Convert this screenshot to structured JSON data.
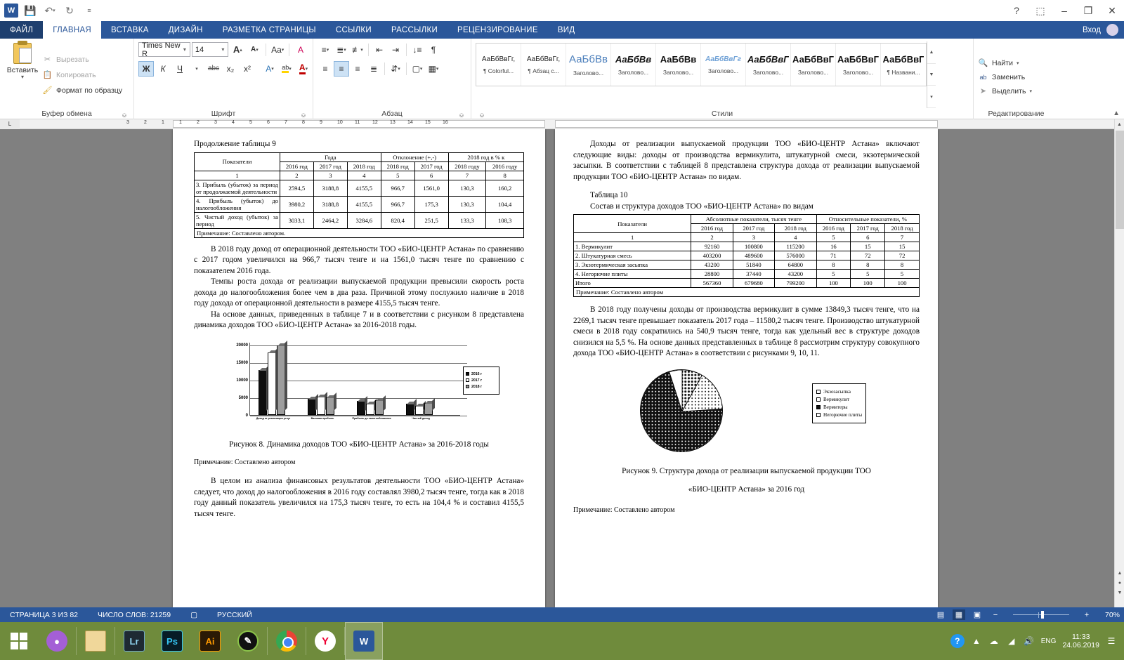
{
  "titlebar": {
    "app_icon": "word-logo",
    "quick_access": [
      {
        "name": "save-icon",
        "glyph": "💾"
      },
      {
        "name": "undo-icon",
        "glyph": "↶"
      },
      {
        "name": "redo-icon",
        "glyph": "↻"
      },
      {
        "name": "customize-qat-icon",
        "glyph": "≡"
      }
    ],
    "window_controls": [
      {
        "name": "help-icon",
        "glyph": "?"
      },
      {
        "name": "ribbon-display-icon",
        "glyph": "⬚"
      },
      {
        "name": "minimize-icon",
        "glyph": "–"
      },
      {
        "name": "restore-icon",
        "glyph": "❐"
      },
      {
        "name": "close-icon",
        "glyph": "✕"
      }
    ]
  },
  "tabs": {
    "file": "ФАЙЛ",
    "items": [
      {
        "label": "ГЛАВНАЯ",
        "active": true
      },
      {
        "label": "ВСТАВКА",
        "active": false
      },
      {
        "label": "ДИЗАЙН",
        "active": false
      },
      {
        "label": "РАЗМЕТКА СТРАНИЦЫ",
        "active": false
      },
      {
        "label": "ССЫЛКИ",
        "active": false
      },
      {
        "label": "РАССЫЛКИ",
        "active": false
      },
      {
        "label": "РЕЦЕНЗИРОВАНИЕ",
        "active": false
      },
      {
        "label": "ВИД",
        "active": false
      }
    ],
    "signin": "Вход"
  },
  "ribbon": {
    "clipboard": {
      "group_label": "Буфер обмена",
      "paste": "Вставить",
      "cut": "Вырезать",
      "copy": "Копировать",
      "format_painter": "Формат по образцу"
    },
    "font": {
      "group_label": "Шрифт",
      "font_name": "Times New R",
      "font_size": "14",
      "bold": "Ж",
      "italic": "К",
      "underline": "Ч",
      "strike": "abc",
      "subscript": "x₂",
      "superscript": "x²",
      "text_effects": "A",
      "highlight": "ab",
      "font_color": "A",
      "grow": "A",
      "shrink": "A",
      "case": "Aa",
      "clear_format": "A"
    },
    "paragraph": {
      "group_label": "Абзац"
    },
    "styles": {
      "group_label": "Стили",
      "items": [
        {
          "sample": "АаБбВвГг,",
          "name": "¶ Colorful...",
          "kind": "plain"
        },
        {
          "sample": "АаБбВвГг,",
          "name": "¶ Абзац с...",
          "kind": "plain"
        },
        {
          "sample": "АаБбВв",
          "name": "Заголово...",
          "kind": "blue-large"
        },
        {
          "sample": "АаБбВв",
          "name": "Заголово...",
          "kind": "bold-italic"
        },
        {
          "sample": "АаБбВв",
          "name": "Заголово...",
          "kind": "bold"
        },
        {
          "sample": "АаБбВвГг",
          "name": "Заголово...",
          "kind": "blue-italic"
        },
        {
          "sample": "АаБбВвГ",
          "name": "Заголово...",
          "kind": "bold-italic"
        },
        {
          "sample": "АаБбВвГ",
          "name": "Заголово...",
          "kind": "bold"
        },
        {
          "sample": "АаБбВвГ",
          "name": "Заголово...",
          "kind": "bold"
        },
        {
          "sample": "АаБбВвГ",
          "name": "¶ Названи...",
          "kind": "bold"
        }
      ]
    },
    "editing": {
      "group_label": "Редактирование",
      "find": "Найти",
      "replace": "Заменить",
      "select": "Выделить"
    }
  },
  "ruler": {
    "corner": "L",
    "numbers": [
      "3",
      "2",
      "1",
      "1",
      "2",
      "3",
      "4",
      "5",
      "6",
      "7",
      "8",
      "9",
      "10",
      "11",
      "12",
      "13",
      "14",
      "15",
      "16"
    ]
  },
  "document": {
    "left_page": {
      "table_caption": "Продолжение таблицы 9",
      "table": {
        "header_top": [
          "Показатели",
          "Года",
          "Отклонение (+,-)",
          "2018 год в % к"
        ],
        "header_sub": [
          "2016 год",
          "2017 год",
          "2018 год",
          "2018 год",
          "2017 год",
          "2018 году",
          "2016 году"
        ],
        "numbering": [
          "1",
          "2",
          "3",
          "4",
          "5",
          "6",
          "7",
          "8"
        ],
        "rows": [
          {
            "label": "3. Прибыль (убыток) за период от продолжаемой деятельности",
            "values": [
              "2594,5",
              "3188,8",
              "4155,5",
              "966,7",
              "1561,0",
              "130,3",
              "160,2"
            ]
          },
          {
            "label": "4. Прибыль (убыток) до налогообложения",
            "values": [
              "3980,2",
              "3188,8",
              "4155,5",
              "966,7",
              "175,3",
              "130,3",
              "104,4"
            ]
          },
          {
            "label": "5. Чистый доход (убыток) за период",
            "values": [
              "3033,1",
              "2464,2",
              "3284,6",
              "820,4",
              "251,5",
              "133,3",
              "108,3"
            ]
          }
        ],
        "note": "Примечание: Составлено автором."
      },
      "paragraphs": [
        "В 2018 году доход от операционной деятельности ТОО «БИО-ЦЕНТР Астана» по сравнению с 2017 годом увеличился на 966,7 тысяч тенге и на 1561,0 тысяч тенге по сравнению с показателем 2016 года.",
        "Темпы роста дохода от реализации выпускаемой продукции превысили скорость роста дохода до налогообложения более чем в два раза. Причиной этому послужило наличие в 2018 году дохода от операционной деятельности в размере 4155,5 тысяч тенге.",
        "На основе данных, приведенных в таблице 7 и в соответствии с рисунком 8 представлена динамика доходов ТОО «БИО-ЦЕНТР Астана» за 2016-2018 годы."
      ],
      "figure8_caption": "Рисунок 8. Динамика доходов ТОО «БИО-ЦЕНТР Астана» за 2016-2018 годы",
      "figure8_note": "Примечание: Составлено автором",
      "closing_paragraph": "В целом из анализа финансовых результатов деятельности ТОО «БИО-ЦЕНТР Астана» следует, что доход до налогообложения в 2016 году составлял 3980,2 тысяч тенге, тогда как в 2018 году данный показатель увеличился на 175,3 тысяч тенге, то есть на 104,4 % и составил 4155,5 тысяч тенге."
    },
    "right_page": {
      "intro_paragraph": "Доходы от реализации выпускаемой продукции ТОО «БИО-ЦЕНТР Астана» включают следующие виды: доходы от производства вермикулита, штукатурной смеси, экзотермической засыпки. В соответствии с таблицей 8 представлена структура дохода от реализации выпускаемой продукции ТОО «БИО-ЦЕНТР Астана» по видам.",
      "table_number": "Таблица 10",
      "table_title": "Состав и структура доходов ТОО «БИО-ЦЕНТР Астана» по видам",
      "table": {
        "header_top": [
          "Показатели",
          "Абсолютные показатели, тысяч тенге",
          "Относительные показатели, %"
        ],
        "header_sub": [
          "2016 год",
          "2017 год",
          "2018 год",
          "2016 год",
          "2017 год",
          "2018 год"
        ],
        "numbering": [
          "1",
          "2",
          "3",
          "4",
          "5",
          "6",
          "7"
        ],
        "rows": [
          {
            "label": "1. Вермикулит",
            "values": [
              "92160",
              "100800",
              "115200",
              "16",
              "15",
              "15"
            ]
          },
          {
            "label": "2. Штукатурная смесь",
            "values": [
              "403200",
              "489600",
              "576000",
              "71",
              "72",
              "72"
            ]
          },
          {
            "label": "3. Экзотермическая засыпка",
            "values": [
              "43200",
              "51840",
              "64800",
              "8",
              "8",
              "8"
            ]
          },
          {
            "label": "4. Негорючие плиты",
            "values": [
              "28800",
              "37440",
              "43200",
              "5",
              "5",
              "5"
            ]
          },
          {
            "label": "Итого",
            "values": [
              "567360",
              "679680",
              "799200",
              "100",
              "100",
              "100"
            ]
          }
        ],
        "note": "Примечание: Составлено автором"
      },
      "body_paragraph": "В 2018 году получены доходы от производства вермикулит в сумме 13849,3 тысяч тенге, что на 2269,1 тысяч тенге превышает показатель 2017 года – 11580,2 тысяч тенге. Производство штукатурной смеси в 2018 году сократились на 540,9 тысяч тенге, тогда как удельный вес в структуре доходов снизился на 5,5 %. На основе данных представленных в таблице 8 рассмотрим структуру совокупного дохода ТОО «БИО-ЦЕНТР Астана» в соответствии с рисунками 9, 10, 11.",
      "figure9_caption_line1": "Рисунок 9. Структура дохода от реализации выпускаемой продукции ТОО",
      "figure9_caption_line2": "«БИО-ЦЕНТР Астана» за 2016 год",
      "figure9_note": "Примечание: Составлено автором"
    }
  },
  "chart_data": [
    {
      "type": "bar",
      "title": "Рисунок 8. Динамика доходов ТОО «БИО-ЦЕНТР Астана» за 2016-2018 годы",
      "categories": [
        "Доход от реализации услуг",
        "Валовая прибыль",
        "Прибыль до налогообложения",
        "Чистый доход"
      ],
      "series": [
        {
          "name": "2016 г",
          "values": [
            12800,
            4500,
            3980,
            3033
          ]
        },
        {
          "name": "2017 г",
          "values": [
            17800,
            5100,
            3188,
            2464
          ]
        },
        {
          "name": "2018 г",
          "values": [
            19800,
            4900,
            4155,
            3284
          ]
        }
      ],
      "yticks": [
        0,
        5000,
        10000,
        15000,
        20000
      ],
      "ylim": [
        0,
        21000
      ],
      "ylabel": "",
      "xlabel": "",
      "legend_position": "right",
      "grid": true
    },
    {
      "type": "pie",
      "title": "Рисунок 9. Структура дохода от реализации выпускаемой продукции ТОО «БИО-ЦЕНТР Астана» за 2016 год",
      "labels": [
        "Экзозасыпка",
        "Вермикулит",
        "Вермитеры",
        "Негорючие плиты"
      ],
      "values": [
        8,
        16,
        71,
        5
      ],
      "unit": "%",
      "legend_position": "right"
    }
  ],
  "statusbar": {
    "page": "СТРАНИЦА 3 ИЗ 82",
    "words": "ЧИСЛО СЛОВ: 21259",
    "proofing_icon": "spelling-icon",
    "language": "РУССКИЙ",
    "zoom": "70%"
  },
  "taskbar": {
    "items": [
      {
        "name": "start-button",
        "label": "Windows"
      },
      {
        "name": "taskbar-app-drop",
        "label": ""
      },
      {
        "name": "taskbar-file-explorer",
        "label": ""
      },
      {
        "name": "taskbar-lightroom",
        "label": "Lr"
      },
      {
        "name": "taskbar-photoshop",
        "label": "Ps"
      },
      {
        "name": "taskbar-illustrator",
        "label": "Ai"
      },
      {
        "name": "taskbar-pen-app",
        "label": ""
      },
      {
        "name": "taskbar-chrome",
        "label": ""
      },
      {
        "name": "taskbar-yandex",
        "label": "Y"
      },
      {
        "name": "taskbar-word",
        "label": "W"
      }
    ],
    "tray": {
      "language": "ENG",
      "time": "11:33",
      "date": "24.06.2019"
    }
  }
}
